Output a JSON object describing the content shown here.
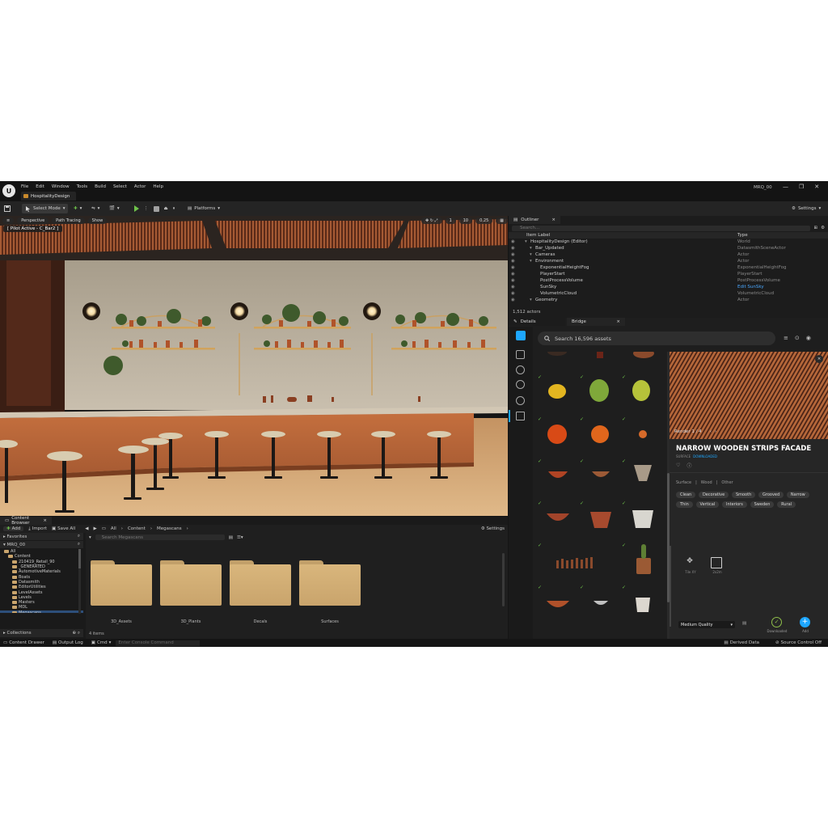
{
  "titlebar": {
    "logo": "U",
    "menu": [
      "File",
      "Edit",
      "Window",
      "Tools",
      "Build",
      "Select",
      "Actor",
      "Help"
    ],
    "document_tab": "HospitalityDesign",
    "project_name": "MRQ_00",
    "window_controls": [
      "—",
      "❐",
      "✕"
    ]
  },
  "toolbar": {
    "select_mode": "Select Mode",
    "platforms": "Platforms",
    "settings": "Settings"
  },
  "viewport": {
    "perspective": "Perspective",
    "path_tracing": "Path Tracing",
    "show": "Show",
    "pilot": "[ Pilot Active - C_Bar2 ]",
    "fov": "10",
    "speed": "0.25",
    "grid": "1"
  },
  "outliner": {
    "tab": "Outliner",
    "search_placeholder": "Search...",
    "col_label": "Item Label",
    "col_type": "Type",
    "rows": [
      {
        "name": "HospitalityDesign (Editor)",
        "type": "World",
        "indent": 3
      },
      {
        "name": "Bar_Updated",
        "type": "DatasmithSceneActor",
        "indent": 4
      },
      {
        "name": "Cameras",
        "type": "Actor",
        "indent": 4
      },
      {
        "name": "Environment",
        "type": "Actor",
        "indent": 4
      },
      {
        "name": "ExponentialHeightFog",
        "type": "ExponentialHeightFog",
        "indent": 5
      },
      {
        "name": "PlayerStart",
        "type": "PlayerStart",
        "indent": 5
      },
      {
        "name": "PostProcessVolume",
        "type": "PostProcessVolume",
        "indent": 5
      },
      {
        "name": "SunSky",
        "type": "Edit SunSky",
        "indent": 5,
        "type_link": true
      },
      {
        "name": "VolumetricCloud",
        "type": "VolumetricCloud",
        "indent": 5
      },
      {
        "name": "Geometry",
        "type": "Actor",
        "indent": 4
      }
    ],
    "actor_count": "1,512 actors"
  },
  "bridge": {
    "tab_details": "Details",
    "tab_bridge": "Bridge",
    "search_placeholder": "Search 16,596 assets",
    "render_counter": "Render 1 / 4",
    "asset_title": "NARROW WOODEN STRIPS FACADE",
    "asset_kind": "SURFACE",
    "asset_status": "DOWNLOADED",
    "breadcrumb": [
      "Surface",
      "Wood",
      "Other"
    ],
    "tags": [
      "Clean",
      "Decorative",
      "Smooth",
      "Grooved",
      "Narrow",
      "Thin",
      "Vertical",
      "Interiors",
      "Sweden",
      "Rural"
    ],
    "tiling_label": "Tile XY",
    "size_label": "2x2m",
    "quality": "Medium Quality",
    "downloaded_label": "Downloaded",
    "add_label": "Add"
  },
  "content_browser": {
    "tab": "Content Browser",
    "add": "Add",
    "import": "Import",
    "save_all": "Save All",
    "path": [
      "All",
      "Content",
      "Megascans"
    ],
    "settings": "Settings",
    "favorites": "Favorites",
    "project": "MRQ_00",
    "search_placeholder": "Search Megascans",
    "tree": [
      "All",
      "Content",
      "210419_Retail_90",
      "_GENERATED",
      "AutomotiveMaterials",
      "Boats",
      "Datasmith",
      "EditorUtilities",
      "LevelAssets",
      "Levels",
      "Masters",
      "MDL",
      "Megascans"
    ],
    "folders": [
      "3D_Assets",
      "3D_Plants",
      "Decals",
      "Surfaces"
    ],
    "item_count": "4 items",
    "collections": "Collections"
  },
  "statusbar": {
    "content_drawer": "Content Drawer",
    "output_log": "Output Log",
    "cmd": "Cmd",
    "console_placeholder": "Enter Console Command",
    "derived_data": "Derived Data",
    "source_control": "Source Control Off"
  },
  "colors": {
    "accent_blue": "#1ea7ff",
    "check_green": "#6ec24a",
    "folder": "#d2b074"
  }
}
